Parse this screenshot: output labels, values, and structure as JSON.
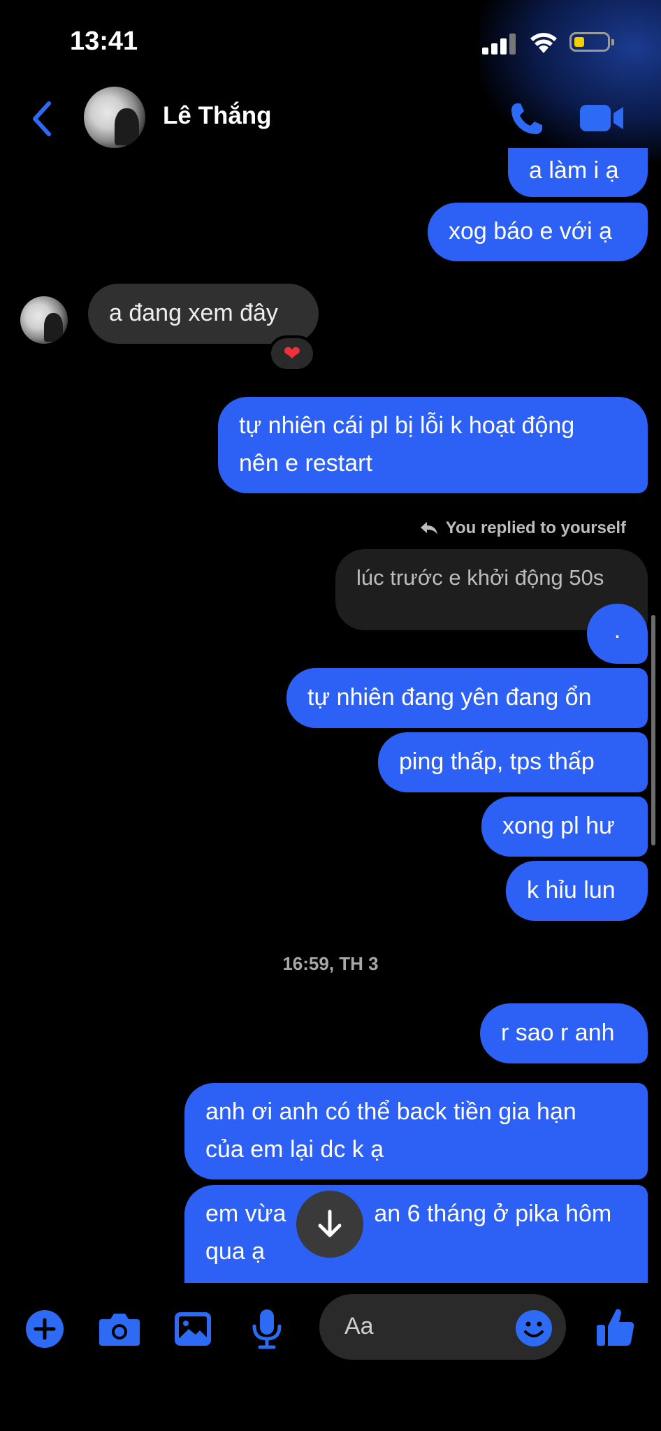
{
  "status_bar": {
    "time": "13:41",
    "battery_level": 0.25
  },
  "header": {
    "contact_name": "Lê Thắng",
    "icons": [
      "chevron-left-icon",
      "phone-icon",
      "video-camera-icon"
    ]
  },
  "messages": {
    "m1": "a làm i ạ",
    "m2": "xog báo e với ạ",
    "m3": "a đang xem đây",
    "m3_reaction": "❤",
    "m4_line1": "tự nhiên cái pl bị lỗi k hoạt động",
    "m4_line2": "nên e restart",
    "replied_label": "You replied to yourself",
    "quoted": "lúc trước e khởi động 50s",
    "m5": ".",
    "m6": "tự nhiên đang yên đang ổn",
    "m7": "ping thấp, tps thấp",
    "m8": "xong pl hư",
    "m9": "k hỉu lun",
    "timestamp": "16:59, TH 3",
    "m10": "r sao r anh",
    "m11_line1": "anh ơi anh có thể back tiền gia hạn",
    "m11_line2": "của em lại dc k ạ",
    "m12_line1a": "em vừa",
    "m12_line1b": "an 6 tháng ở pika hôm",
    "m12_line2": "qua ạ"
  },
  "composer": {
    "placeholder": "Aa",
    "icons": [
      "plus-icon",
      "camera-icon",
      "image-icon",
      "microphone-icon",
      "emoji-icon",
      "thumbs-up-icon"
    ]
  },
  "colors": {
    "accent": "#2d60f5",
    "incoming": "#303030",
    "background": "#000000"
  }
}
